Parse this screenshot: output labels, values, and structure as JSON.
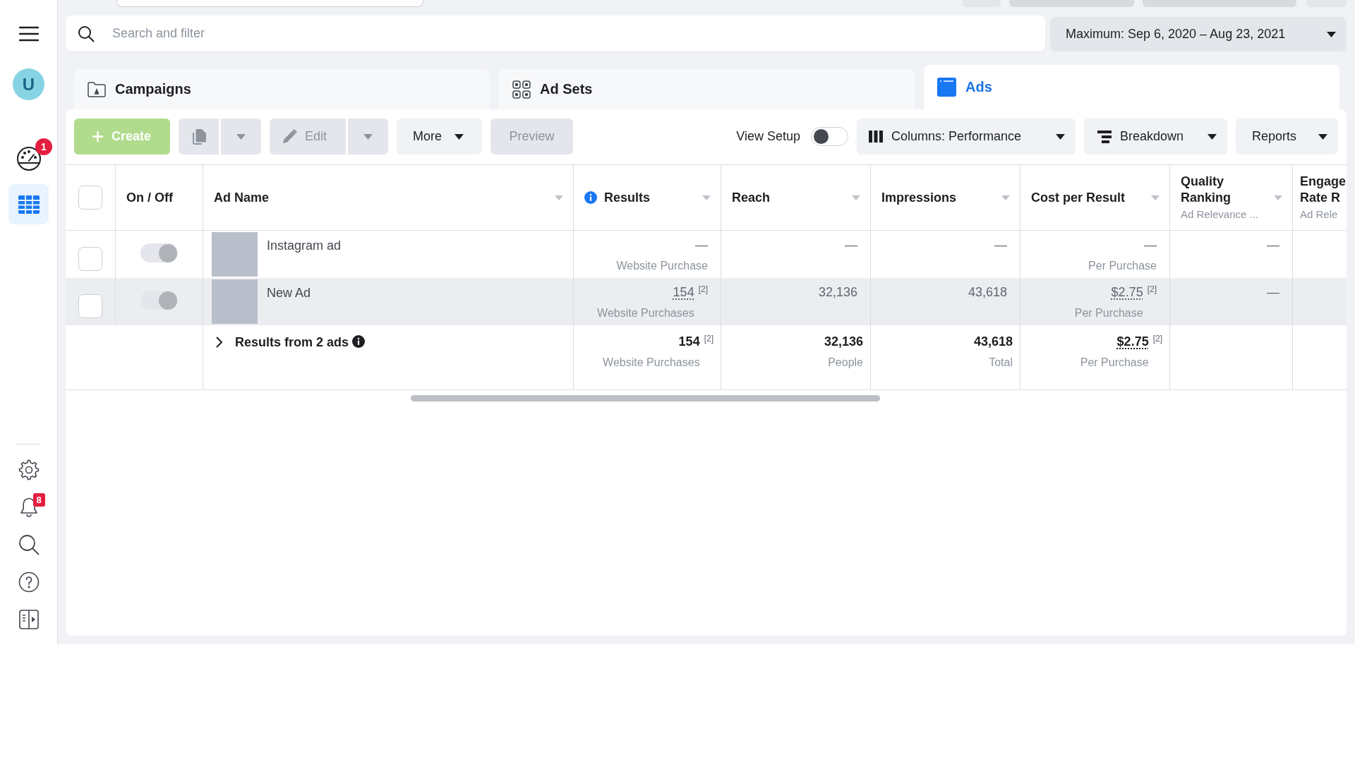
{
  "sidebar": {
    "avatar": {
      "initial": "U"
    },
    "items": [
      {
        "kind": "gauge",
        "badge": "1",
        "selected": false
      },
      {
        "kind": "table",
        "selected": true
      }
    ],
    "bottom_items": [
      {
        "kind": "settings"
      },
      {
        "kind": "bell",
        "badge": "8"
      },
      {
        "kind": "search"
      },
      {
        "kind": "help"
      },
      {
        "kind": "panel"
      }
    ]
  },
  "search": {
    "placeholder": "Search and filter"
  },
  "date_range": {
    "label": "Maximum: Sep 6, 2020 – Aug 23, 2021"
  },
  "tabs": [
    {
      "kind": "campaigns",
      "label": "Campaigns",
      "selected": false
    },
    {
      "kind": "ad_sets",
      "label": "Ad Sets",
      "selected": false
    },
    {
      "kind": "ads",
      "label": "Ads",
      "selected": true
    }
  ],
  "toolbar": {
    "left": [
      {
        "kind": "create",
        "label": "Create",
        "disabled": true
      },
      {
        "kind": "duplicate",
        "disabled": true
      },
      {
        "kind": "edit",
        "label": "Edit",
        "disabled": true
      },
      {
        "kind": "menu",
        "label": "More",
        "disabled": false
      },
      {
        "kind": "plain",
        "label": "Preview",
        "disabled": true
      }
    ],
    "view_setup": {
      "label": "View Setup",
      "on": false
    },
    "right": [
      {
        "kind": "columns",
        "label": "Columns: Performance"
      },
      {
        "kind": "breakdown",
        "label": "Breakdown"
      },
      {
        "kind": "reports",
        "label": "Reports"
      }
    ]
  },
  "table": {
    "select_all": {
      "checked": false
    },
    "columns": [
      {
        "title": "On / Off",
        "dropdown": false
      },
      {
        "title": "Ad Name",
        "dropdown": true
      },
      {
        "title": "Results",
        "info": true,
        "dropdown": true
      },
      {
        "title": "Reach",
        "dropdown": true
      },
      {
        "title": "Impressions",
        "dropdown": true
      },
      {
        "title": "Cost per Result",
        "dropdown": true
      },
      {
        "title": "Quality Ranking",
        "subtitle": "Ad Relevance ...",
        "dropdown": true
      },
      {
        "title": "Engage Rate R",
        "subtitle": "Ad Rele",
        "dropdown": false
      }
    ],
    "rows": [
      {
        "checked": false,
        "hovered": false,
        "cells": [
          {
            "kind": "toggle",
            "on": true,
            "disabled": true
          },
          {
            "kind": "ad",
            "name": "Instagram ad"
          },
          {
            "kind": "metric",
            "value": "—",
            "caption": "Website Purchase"
          },
          {
            "kind": "metric",
            "value": "—"
          },
          {
            "kind": "metric",
            "value": "—"
          },
          {
            "kind": "metric",
            "value": "—",
            "caption": "Per Purchase"
          },
          {
            "kind": "metric",
            "value": "—"
          }
        ]
      },
      {
        "checked": false,
        "hovered": true,
        "cells": [
          {
            "kind": "toggle",
            "on": true,
            "disabled": true
          },
          {
            "kind": "ad",
            "name": "New Ad"
          },
          {
            "kind": "metric",
            "value": "154",
            "note": "[2]",
            "underlined": true,
            "caption": "Website Purchases"
          },
          {
            "kind": "metric",
            "value": "32,136"
          },
          {
            "kind": "metric",
            "value": "43,618"
          },
          {
            "kind": "metric",
            "value": "$2.75",
            "note": "[2]",
            "underlined": true,
            "caption": "Per Purchase"
          },
          {
            "kind": "metric",
            "value": "—"
          }
        ]
      }
    ],
    "summary": {
      "cells": [
        "",
        {
          "kind": "summary",
          "label": "Results from 2 ads",
          "expanded": false,
          "info": true
        },
        {
          "kind": "metric",
          "value": "154",
          "note": "[2]",
          "caption": "Website Purchases"
        },
        {
          "kind": "metric",
          "value": "32,136",
          "caption": "People"
        },
        {
          "kind": "metric",
          "value": "43,618",
          "caption": "Total"
        },
        {
          "kind": "metric",
          "value": "$2.75",
          "note": "[2]",
          "underlined": true,
          "caption": "Per Purchase"
        }
      ]
    }
  }
}
